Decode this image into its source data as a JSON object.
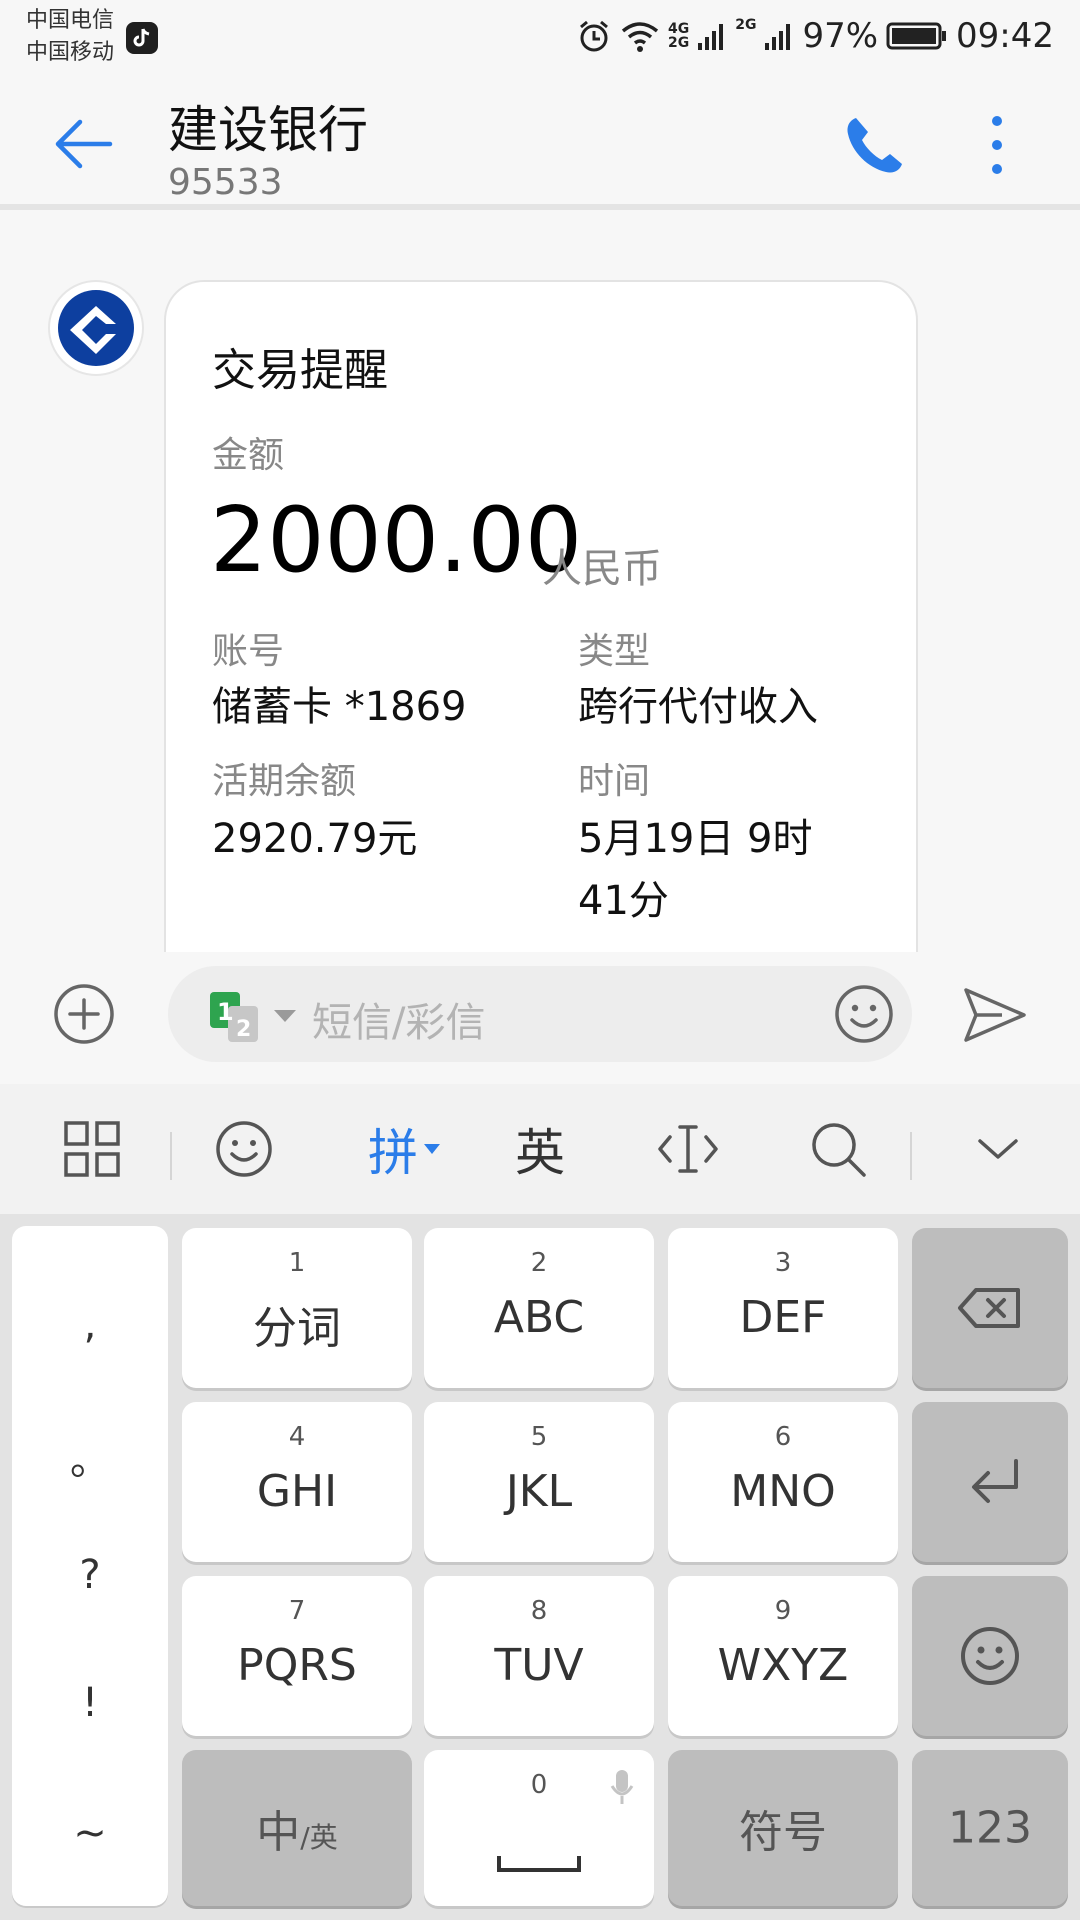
{
  "status_bar": {
    "carrier1": "中国电信",
    "carrier2": "中国移动",
    "net_top": "4G",
    "net_bottom": "2G",
    "net2": "2G",
    "battery": "97%",
    "time": "09:42"
  },
  "header": {
    "title": "建设银行",
    "subtitle": "95533"
  },
  "message": {
    "heading": "交易提醒",
    "amount_label": "金额",
    "amount": "2000.00",
    "currency": "人民币",
    "account_label": "账号",
    "account_value": "储蓄卡 *1869",
    "type_label": "类型",
    "type_value": "跨行代付收入",
    "balance_label": "活期余额",
    "balance_value": "2920.79元",
    "time_label": "时间",
    "time_line1": "5月19日 9时",
    "time_line2": "41分"
  },
  "compose": {
    "sim1": "1",
    "sim2": "2",
    "placeholder": "短信/彩信"
  },
  "keyboard_toolbar": {
    "pinyin": "拼",
    "english": "英"
  },
  "keypad": {
    "punct": [
      ",",
      "。",
      "?",
      "!",
      "~"
    ],
    "keys": [
      {
        "num": "1",
        "letters": "分词"
      },
      {
        "num": "2",
        "letters": "ABC"
      },
      {
        "num": "3",
        "letters": "DEF"
      },
      {
        "num": "4",
        "letters": "GHI"
      },
      {
        "num": "5",
        "letters": "JKL"
      },
      {
        "num": "6",
        "letters": "MNO"
      },
      {
        "num": "7",
        "letters": "PQRS"
      },
      {
        "num": "8",
        "letters": "TUV"
      },
      {
        "num": "9",
        "letters": "WXYZ"
      }
    ],
    "zero": "0",
    "lang_main": "中",
    "lang_sub": "/英",
    "symbols": "符号",
    "numbers": "123"
  },
  "colors": {
    "accent": "#2b7de9",
    "bank_blue": "#0d3f9f"
  }
}
